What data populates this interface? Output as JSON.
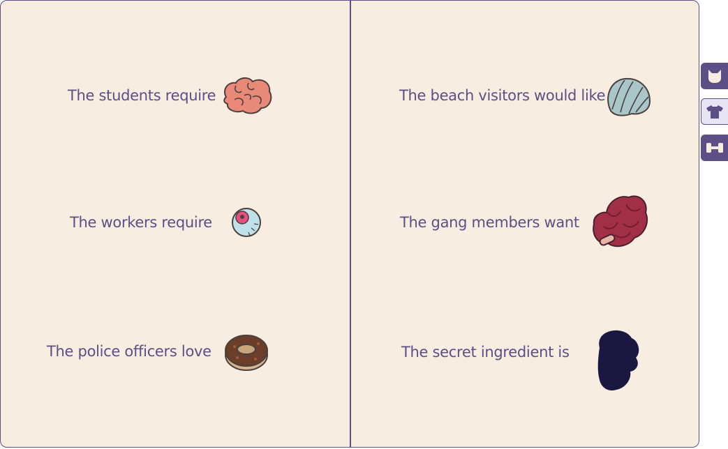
{
  "left_page": {
    "rows": [
      {
        "text": "The students require",
        "item": "brain-icon"
      },
      {
        "text": "The workers require",
        "item": "eyeball-icon"
      },
      {
        "text": "The police officers love",
        "item": "donut-icon"
      }
    ]
  },
  "right_page": {
    "rows": [
      {
        "text": "The beach visitors would like",
        "item": "seashell-icon"
      },
      {
        "text": "The gang members want",
        "item": "raw-meat-icon"
      },
      {
        "text": "The secret ingredient is",
        "item": "unknown-silhouette-icon"
      }
    ]
  },
  "side_tabs": [
    {
      "icon": "cat-icon",
      "active": false
    },
    {
      "icon": "shirt-icon",
      "active": true
    },
    {
      "icon": "dumbbell-icon",
      "active": false
    }
  ],
  "colors": {
    "paper": "#f7ede0",
    "ink": "#5b4f86",
    "tab_active_bg": "#e7e4f5"
  }
}
